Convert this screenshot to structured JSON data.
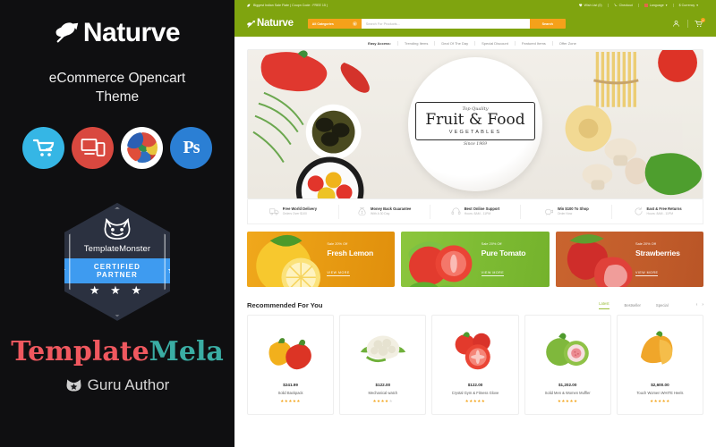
{
  "promo": {
    "brand": "Naturve",
    "logo_icon": "leaf-icon",
    "subtitle": "eCommerce Opencart Theme",
    "tech_badges": [
      {
        "name": "opencart-icon",
        "label": "OpenCart"
      },
      {
        "name": "responsive-icon",
        "label": "Responsive"
      },
      {
        "name": "multilanguage-icon",
        "label": "Multi Language"
      },
      {
        "name": "photoshop-icon",
        "label": "Ps"
      }
    ],
    "certified_badge": {
      "monster_icon": "monster-face-icon",
      "vendor": "TemplateMonster",
      "ribbon": "CERTIFIED PARTNER",
      "stars": "★ ★ ★"
    },
    "author": {
      "name_part1": "Template",
      "name_part2": "Mela",
      "role": "Guru Author",
      "role_icon": "monster-head-icon"
    },
    "colors": {
      "background": "#0f0f11",
      "accent_red": "#f0585f",
      "accent_teal": "#3aada4",
      "ribbon_blue": "#3e9bf0"
    }
  },
  "site": {
    "colors": {
      "header_green": "#7fa40f",
      "accent_orange": "#f5a11a",
      "tab_green": "#9bbf3a"
    },
    "topbar": {
      "promo_icon": "leaf-icon",
      "promo_text": "Biggest Indian Sale Flate ( Coupn Code : FREE 15 )",
      "links": [
        {
          "icon": "heart-icon",
          "label": "Wish List (0)"
        },
        {
          "icon": "cart-icon",
          "label": "Checkout"
        },
        {
          "icon": "flag-icon",
          "label": "Language",
          "caret": "▾"
        },
        {
          "icon": "dollar-icon",
          "label": "$ Currency",
          "caret": "▾"
        }
      ]
    },
    "header": {
      "brand": "Naturve",
      "brand_icon": "leaf-icon",
      "category_select": "All Categories",
      "category_caret_icon": "chevron-down-icon",
      "search_placeholder": "Search For Products...",
      "search_button": "Search",
      "account_icon": "user-icon",
      "cart_icon": "cart-icon",
      "cart_count": "0"
    },
    "nav": {
      "label": "Easy Access:",
      "items": [
        "Trending Items",
        "Deal Of The Day",
        "Special Discount",
        "Featured Items",
        "Offer Zone"
      ]
    },
    "hero": {
      "top_text": "Top Quality",
      "title": "Fruit & Food",
      "subtitle": "VEGETABLES",
      "since": "Since 1969"
    },
    "features": [
      {
        "icon": "truck-icon",
        "title": "Free World Delivery",
        "sub": "Orders Over $100"
      },
      {
        "icon": "moneybag-icon",
        "title": "Money Back Guarantee",
        "sub": "With A 30 Day"
      },
      {
        "icon": "headset-icon",
        "title": "Best Online Support",
        "sub": "Hours: 8AM - 11PM"
      },
      {
        "icon": "piggy-icon",
        "title": "Win $100 To Shop",
        "sub": "Order Now"
      },
      {
        "icon": "return-icon",
        "title": "East & Free Returns",
        "sub": "Hours: 8AM - 11PM"
      }
    ],
    "promo_banners": [
      {
        "sale": "Sale 20% Off",
        "title": "Fresh Lemon",
        "cta": "VIEW MORE",
        "art": "lemon-image"
      },
      {
        "sale": "Sale 20% Off",
        "title": "Pure Tomato",
        "cta": "VIEW MORE",
        "art": "tomato-image"
      },
      {
        "sale": "Sale 20% Off",
        "title": "Strawberries",
        "cta": "VIEW MORE",
        "art": "strawberry-image"
      }
    ],
    "recommended": {
      "title": "Recommended For You",
      "tabs": [
        "Latest",
        "Bestseller",
        "Special"
      ],
      "active_tab": "Latest",
      "prev_icon": "chevron-left-icon",
      "next_icon": "chevron-right-icon",
      "products": [
        {
          "price": "$241.99",
          "name": "Solid Backpack",
          "rating": 5,
          "art": "peppers-image"
        },
        {
          "price": "$122.00",
          "name": "Mechanical watch",
          "rating": 4,
          "art": "cauliflower-image"
        },
        {
          "price": "$122.00",
          "name": "Crystal Gym & Fitness Glove",
          "rating": 5,
          "art": "tomatoes-image"
        },
        {
          "price": "$1,202.00",
          "name": "Solid Men & Women Muffler",
          "rating": 5,
          "art": "guava-image"
        },
        {
          "price": "$2,600.00",
          "name": "Touch Women WHITE Heels",
          "rating": 5,
          "art": "papaya-image"
        }
      ]
    }
  }
}
